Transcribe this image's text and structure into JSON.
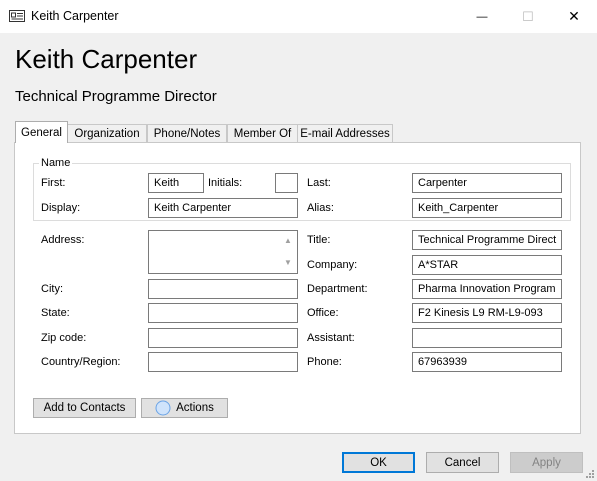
{
  "window": {
    "title": "Keith Carpenter",
    "minimize": "—",
    "maximize": "☐",
    "close": "✕"
  },
  "header": {
    "name": "Keith Carpenter",
    "job_title": "Technical Programme Director"
  },
  "tabs": [
    {
      "label": "General",
      "active": true
    },
    {
      "label": "Organization"
    },
    {
      "label": "Phone/Notes"
    },
    {
      "label": "Member Of"
    },
    {
      "label": "E-mail Addresses"
    }
  ],
  "name_group": {
    "label": "Name",
    "first_label": "First:",
    "first_value": "Keith",
    "initials_label": "Initials:",
    "initials_value": "",
    "last_label": "Last:",
    "last_value": "Carpenter",
    "display_label": "Display:",
    "display_value": "Keith Carpenter",
    "alias_label": "Alias:",
    "alias_value": "Keith_Carpenter"
  },
  "address": {
    "address_label": "Address:",
    "address_value": "",
    "city_label": "City:",
    "city_value": "",
    "state_label": "State:",
    "state_value": "",
    "zip_label": "Zip code:",
    "zip_value": "",
    "country_label": "Country/Region:",
    "country_value": ""
  },
  "work": {
    "title_label": "Title:",
    "title_value": "Technical Programme Direct",
    "company_label": "Company:",
    "company_value": "A*STAR",
    "department_label": "Department:",
    "department_value": "Pharma Innovation Program",
    "office_label": "Office:",
    "office_value": "F2 Kinesis L9 RM-L9-093",
    "assistant_label": "Assistant:",
    "assistant_value": "",
    "phone_label": "Phone:",
    "phone_value": "67963939"
  },
  "actions": {
    "add_to_contacts": "Add to Contacts",
    "actions": "Actions"
  },
  "footer": {
    "ok": "OK",
    "cancel": "Cancel",
    "apply": "Apply"
  },
  "colors": {
    "accent": "#0078d7",
    "panel_bg": "#ffffff",
    "window_bg": "#f0f0f0"
  }
}
